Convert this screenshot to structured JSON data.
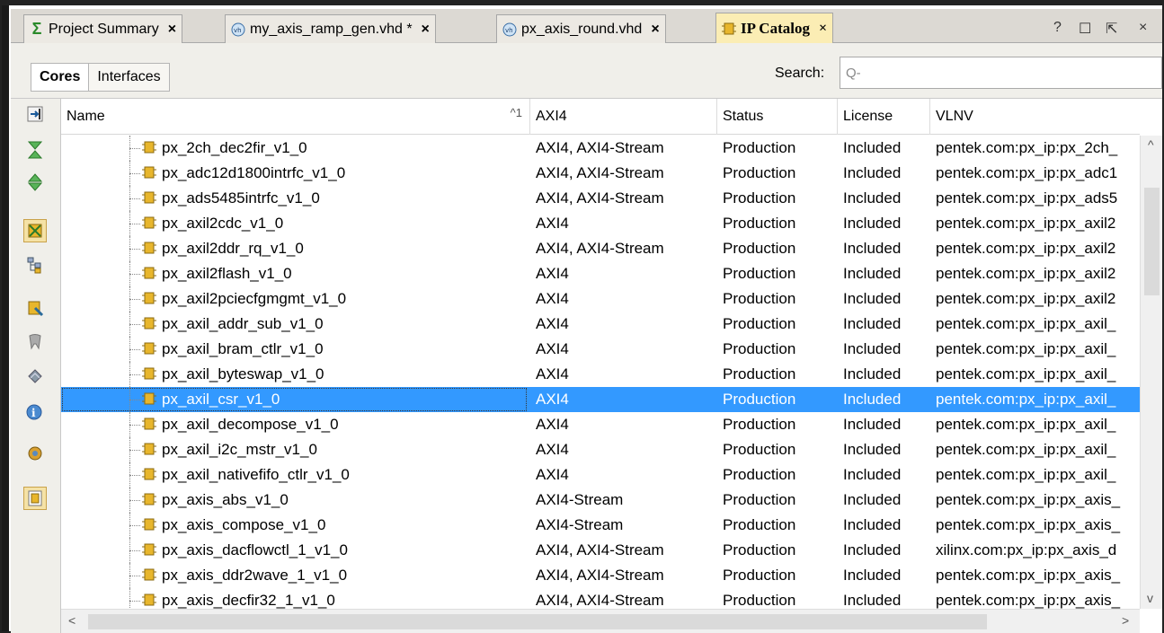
{
  "tabs": [
    {
      "label": "Project Summary",
      "icon": "sigma-icon",
      "close": "×"
    },
    {
      "label": "my_axis_ramp_gen.vhd *",
      "icon": "vhdl-file-icon",
      "close": "×"
    },
    {
      "label": "px_axis_round.vhd",
      "icon": "vhdl-file-icon",
      "close": "×"
    },
    {
      "label": "IP Catalog",
      "icon": "ip-core-icon",
      "close": "×"
    }
  ],
  "window_controls": {
    "help": "?",
    "restore": "☐",
    "float": "⇱",
    "close": "×"
  },
  "view_toggle": {
    "cores": "Cores",
    "interfaces": "Interfaces"
  },
  "search": {
    "label": "Search:",
    "placeholder": "Q-"
  },
  "columns": {
    "name": "Name",
    "sort": "^1",
    "axi4": "AXI4",
    "status": "Status",
    "license": "License",
    "vlnv": "VLNV"
  },
  "rows": [
    {
      "name": "px_2ch_dec2fir_v1_0",
      "axi": "AXI4, AXI4-Stream",
      "status": "Production",
      "license": "Included",
      "vlnv": "pentek.com:px_ip:px_2ch_"
    },
    {
      "name": "px_adc12d1800intrfc_v1_0",
      "axi": "AXI4, AXI4-Stream",
      "status": "Production",
      "license": "Included",
      "vlnv": "pentek.com:px_ip:px_adc1"
    },
    {
      "name": "px_ads5485intrfc_v1_0",
      "axi": "AXI4, AXI4-Stream",
      "status": "Production",
      "license": "Included",
      "vlnv": "pentek.com:px_ip:px_ads5"
    },
    {
      "name": "px_axil2cdc_v1_0",
      "axi": "AXI4",
      "status": "Production",
      "license": "Included",
      "vlnv": "pentek.com:px_ip:px_axil2"
    },
    {
      "name": "px_axil2ddr_rq_v1_0",
      "axi": "AXI4, AXI4-Stream",
      "status": "Production",
      "license": "Included",
      "vlnv": "pentek.com:px_ip:px_axil2"
    },
    {
      "name": "px_axil2flash_v1_0",
      "axi": "AXI4",
      "status": "Production",
      "license": "Included",
      "vlnv": "pentek.com:px_ip:px_axil2"
    },
    {
      "name": "px_axil2pciecfgmgmt_v1_0",
      "axi": "AXI4",
      "status": "Production",
      "license": "Included",
      "vlnv": "pentek.com:px_ip:px_axil2"
    },
    {
      "name": "px_axil_addr_sub_v1_0",
      "axi": "AXI4",
      "status": "Production",
      "license": "Included",
      "vlnv": "pentek.com:px_ip:px_axil_"
    },
    {
      "name": "px_axil_bram_ctlr_v1_0",
      "axi": "AXI4",
      "status": "Production",
      "license": "Included",
      "vlnv": "pentek.com:px_ip:px_axil_"
    },
    {
      "name": "px_axil_byteswap_v1_0",
      "axi": "AXI4",
      "status": "Production",
      "license": "Included",
      "vlnv": "pentek.com:px_ip:px_axil_"
    },
    {
      "name": "px_axil_csr_v1_0",
      "axi": "AXI4",
      "status": "Production",
      "license": "Included",
      "vlnv": "pentek.com:px_ip:px_axil_"
    },
    {
      "name": "px_axil_decompose_v1_0",
      "axi": "AXI4",
      "status": "Production",
      "license": "Included",
      "vlnv": "pentek.com:px_ip:px_axil_"
    },
    {
      "name": "px_axil_i2c_mstr_v1_0",
      "axi": "AXI4",
      "status": "Production",
      "license": "Included",
      "vlnv": "pentek.com:px_ip:px_axil_"
    },
    {
      "name": "px_axil_nativefifo_ctlr_v1_0",
      "axi": "AXI4",
      "status": "Production",
      "license": "Included",
      "vlnv": "pentek.com:px_ip:px_axil_"
    },
    {
      "name": "px_axis_abs_v1_0",
      "axi": "AXI4-Stream",
      "status": "Production",
      "license": "Included",
      "vlnv": "pentek.com:px_ip:px_axis_"
    },
    {
      "name": "px_axis_compose_v1_0",
      "axi": "AXI4-Stream",
      "status": "Production",
      "license": "Included",
      "vlnv": "pentek.com:px_ip:px_axis_"
    },
    {
      "name": "px_axis_dacflowctl_1_v1_0",
      "axi": "AXI4, AXI4-Stream",
      "status": "Production",
      "license": "Included",
      "vlnv": "xilinx.com:px_ip:px_axis_d"
    },
    {
      "name": "px_axis_ddr2wave_1_v1_0",
      "axi": "AXI4, AXI4-Stream",
      "status": "Production",
      "license": "Included",
      "vlnv": "pentek.com:px_ip:px_axis_"
    },
    {
      "name": "px_axis_decfir32_1_v1_0",
      "axi": "AXI4, AXI4-Stream",
      "status": "Production",
      "license": "Included",
      "vlnv": "pentek.com:px_ip:px_axis_"
    }
  ],
  "selected_row": "px_axil_csr_v1_0",
  "toolbar_icons": [
    "collapse-all-icon",
    "expand-all-icon",
    "expand-selected-icon",
    "group-by-icon",
    "customize-ip-icon",
    "filter-icon",
    "repository-icon",
    "ip-details-icon",
    "settings-icon",
    "ip-summary-icon"
  ],
  "colors": {
    "selection": "#3399ff",
    "active_tab": "#fbedb4"
  }
}
